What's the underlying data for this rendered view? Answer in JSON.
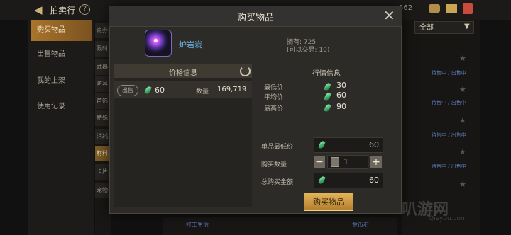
{
  "header": {
    "title": "拍卖行",
    "currency_fragment": "562"
  },
  "sidebar": {
    "items": [
      {
        "label": "购买物品",
        "active": true
      },
      {
        "label": "出售物品",
        "active": false
      },
      {
        "label": "我的上架",
        "active": false
      },
      {
        "label": "使用记录",
        "active": false
      }
    ]
  },
  "categories": [
    "点券",
    "限时",
    "武器",
    "防具",
    "首饰",
    "特殊",
    "消耗",
    "材料",
    "卡片",
    "宠物"
  ],
  "filter": {
    "selected": "全部"
  },
  "right_list": {
    "tag": "待售中 / 出售中"
  },
  "modal": {
    "title": "购买物品",
    "item": {
      "name": "炉岩炭",
      "owned": "拥有: 725",
      "tradable": "(可以交易: 10)"
    },
    "price_info": {
      "title": "价格信息",
      "listing": {
        "tag": "出售",
        "price": "60",
        "qty_label": "数量",
        "qty": "169,719"
      }
    },
    "market_info": {
      "title": "行情信息",
      "rows": [
        {
          "label": "最低价",
          "value": "30"
        },
        {
          "label": "平均价",
          "value": "60"
        },
        {
          "label": "最高价",
          "value": "90"
        }
      ]
    },
    "form": {
      "unit_min_label": "单品最低价",
      "unit_min_value": "60",
      "qty_label": "购买数量",
      "qty_value": "1",
      "total_label": "总购买金额",
      "total_value": "60"
    },
    "buy_label": "购买物品"
  },
  "bottom": {
    "tag1": "打工生活",
    "tag2": "金币石"
  },
  "watermark": {
    "text": "叭游网",
    "sub": "Qieyou.com"
  },
  "colors": {
    "accent": "#c99a45",
    "gem": "#3fae67",
    "item_name": "#6fb7e6"
  }
}
